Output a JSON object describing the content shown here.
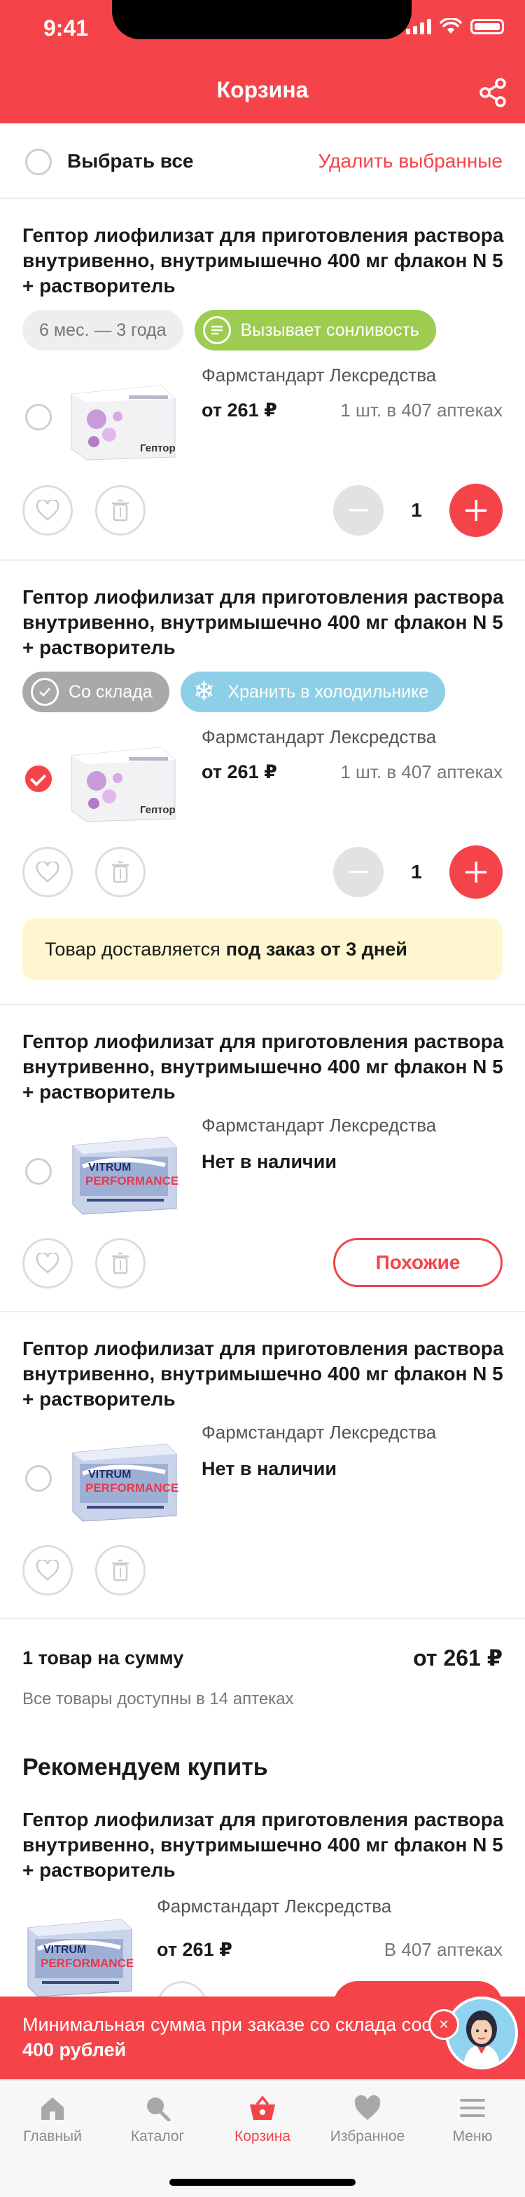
{
  "status_bar": {
    "time": "9:41"
  },
  "header": {
    "title": "Корзина"
  },
  "select_row": {
    "select_all": "Выбрать все",
    "delete_selected": "Удалить выбранные"
  },
  "cards": [
    {
      "title": "Гептор лиофилизат для приготовления раствора внутривенно, внутримышечно 400 мг флакон N 5 + растворитель",
      "chips": [
        "6 мес. — 3 года",
        "Вызывает сонливость"
      ],
      "maker": "Фармстандарт Лексредства",
      "price": "от 261 ₽",
      "availability": "1 шт. в 407 аптеках",
      "qty": "1",
      "checked": false
    },
    {
      "title": "Гептор лиофилизат для приготовления раствора внутривенно, внутримышечно 400 мг флакон N 5 + растворитель",
      "chips": [
        "Со склада",
        "Хранить в холодильнике"
      ],
      "maker": "Фармстандарт Лексредства",
      "price": "от 261 ₽",
      "availability": "1 шт. в 407 аптеках",
      "qty": "1",
      "checked": true,
      "notice_text": "Товар доставляется",
      "notice_bold": "под заказ от 3 дней"
    },
    {
      "title": "Гептор лиофилизат для приготовления раствора внутривенно, внутримышечно 400 мг флакон N 5 + растворитель",
      "maker": "Фармстандарт Лексредства",
      "stock": "Нет в наличии",
      "similar": "Похожие",
      "checked": false
    },
    {
      "title": "Гептор лиофилизат для приготовления раствора внутривенно, внутримышечно 400 мг флакон N 5 + растворитель",
      "maker": "Фармстандарт Лексредства",
      "stock": "Нет в наличии",
      "checked": false
    }
  ],
  "image_text": {
    "heptor_box": "Гептор"
  },
  "summary": {
    "label": "1 товар на сумму",
    "value": "от 261 ₽",
    "sub": "Все товары доступны в 14 аптеках"
  },
  "recommend": {
    "title": "Рекомендуем купить",
    "product_title": "Гептор лиофилизат для приготовления раствора внутривенно, внутримышечно 400 мг флакон N 5 + растворитель",
    "maker": "Фармстандарт Лексредства",
    "price": "от 261 ₽",
    "availability": "В 407 аптеках"
  },
  "min_sum": {
    "text": "Минимальная сумма при заказе со склада составляет",
    "bold": "400 рублей"
  },
  "tabs": [
    {
      "label": "Главный",
      "icon": "home-icon"
    },
    {
      "label": "Каталог",
      "icon": "search-icon"
    },
    {
      "label": "Корзина",
      "icon": "basket-icon",
      "active": true
    },
    {
      "label": "Избранное",
      "icon": "heart-icon"
    },
    {
      "label": "Меню",
      "icon": "menu-icon"
    }
  ],
  "colors": {
    "accent": "#f4444a",
    "green_chip": "#9ccc50",
    "blue_chip": "#8ccfe6",
    "notice_bg": "#fff6cf"
  }
}
